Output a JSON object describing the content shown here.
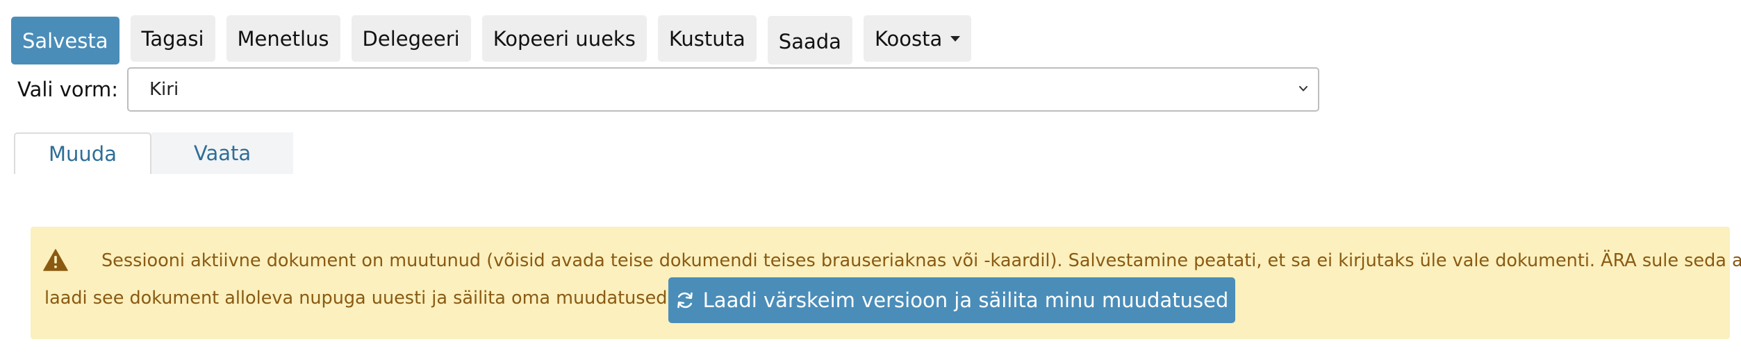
{
  "toolbar": {
    "save_label": "Salvesta",
    "back_label": "Tagasi",
    "procedure_label": "Menetlus",
    "delegate_label": "Delegeeri",
    "copy_new_label": "Kopeeri uueks",
    "delete_label": "Kustuta",
    "send_label": "Saada",
    "compose_label": "Koosta",
    "compose_icon": "chevron-down-icon"
  },
  "form_select": {
    "label": "Vali vorm:",
    "value": "Kiri",
    "icon": "chevron-down-icon"
  },
  "tabs": [
    {
      "label": "Muuda",
      "active": true
    },
    {
      "label": "Vaata",
      "active": false
    }
  ],
  "alert": {
    "icon": "warning-triangle-icon",
    "line1": "Sessiooni aktiivne dokument on muutunud (võisid avada teise dokumendi teises brauseriaknas või -kaardil). Salvestamine peatati, et sa ei kirjutaks üle vale dokumenti. ÄRA sule seda akent –",
    "line2": "laadi see dokument alloleva nupuga uuesti ja säilita oma muudatused.",
    "button_label": "Laadi värskeim versioon ja säilita minu muudatused",
    "button_icon": "refresh-icon"
  },
  "colors": {
    "primary": "#4a8db9",
    "tab_text": "#2e6e96",
    "alert_bg": "#fbf0be",
    "alert_text": "#8a5a12"
  }
}
